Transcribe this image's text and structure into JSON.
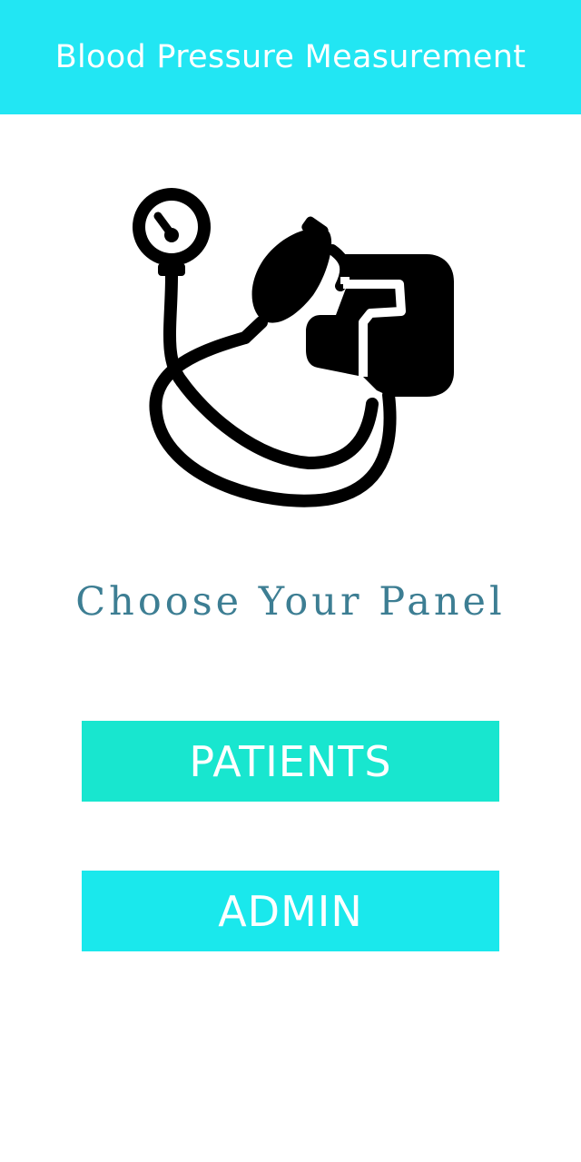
{
  "app_bar": {
    "title": "Blood Pressure Measurement",
    "color": "#22e6f3"
  },
  "hero": {
    "icon": "blood-pressure-monitor-icon"
  },
  "heading": {
    "text": "Choose Your Panel",
    "color": "#3d7e93"
  },
  "buttons": {
    "patients": {
      "label": "PATIENTS",
      "color": "#18e6cf"
    },
    "admin": {
      "label": "ADMIN",
      "color": "#1ae8ec"
    }
  }
}
